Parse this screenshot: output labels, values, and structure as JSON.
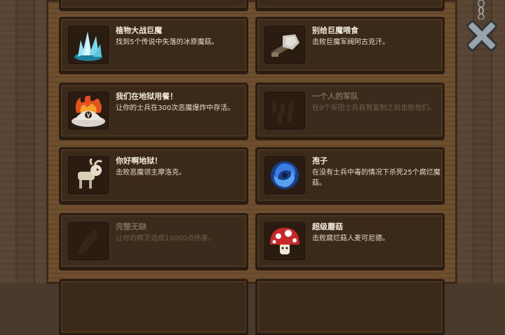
{
  "achievements": [
    {
      "title": "植物大战巨魔",
      "desc": "找到5个传说中失落的冰原魔菇。",
      "icon": "ice-crystal-icon",
      "locked": false
    },
    {
      "title": "别给巨魔喂食",
      "desc": "击败巨魔军阀阿古克汗。",
      "icon": "stone-hammer-icon",
      "locked": false
    },
    {
      "title": "我们在地狱用餐！",
      "desc": "让你的士兵在300次恶魔爆炸中存活。",
      "icon": "fire-dish-icon",
      "locked": false
    },
    {
      "title": "一个人的军队",
      "desc": "在9个军团士兵自我复制之前击败他们。",
      "icon": "army-icon",
      "locked": true
    },
    {
      "title": "你好啊地狱！",
      "desc": "击败恶魔领主摩洛克。",
      "icon": "skull-beast-icon",
      "locked": false
    },
    {
      "title": "孢子",
      "desc": "在没有士兵中毒的情况下杀死25个腐烂魔菇。",
      "icon": "spore-vortex-icon",
      "locked": false
    },
    {
      "title": "完整无缺",
      "desc": "让你的精灵造成10000点伤害。",
      "icon": "elf-icon",
      "locked": true
    },
    {
      "title": "超级蘑菇",
      "desc": "击败腐烂菇人麦可尼德。",
      "icon": "red-mushroom-icon",
      "locked": false
    }
  ],
  "close": {
    "icon": "close-x-icon"
  }
}
